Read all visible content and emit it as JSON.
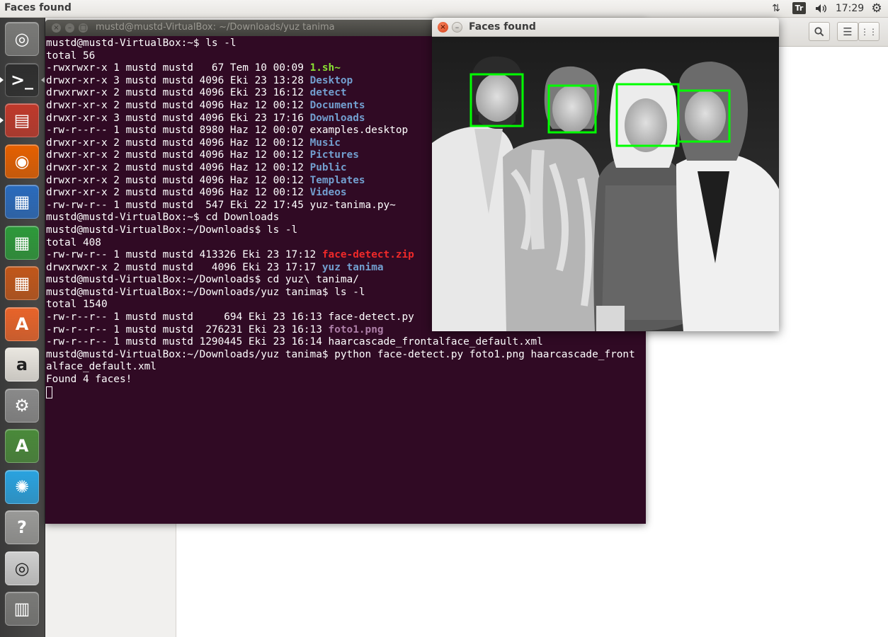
{
  "top_panel": {
    "app_title": "Faces found",
    "keyboard_indicator": "Tr",
    "clock": "17:29"
  },
  "launcher": {
    "items": [
      {
        "name": "dash-home-icon",
        "glyph": "◎",
        "color": "#7a7a78"
      },
      {
        "name": "terminal-icon",
        "glyph": ">_",
        "color": "#2e2e2e"
      },
      {
        "name": "files-icon",
        "glyph": "▤",
        "color": "#c0392b"
      },
      {
        "name": "firefox-icon",
        "glyph": "◉",
        "color": "#e66000"
      },
      {
        "name": "writer-icon",
        "glyph": "▦",
        "color": "#2a6bbd"
      },
      {
        "name": "calc-icon",
        "glyph": "▦",
        "color": "#2d9a3a"
      },
      {
        "name": "impress-icon",
        "glyph": "▦",
        "color": "#c2571a"
      },
      {
        "name": "software-center-icon",
        "glyph": "A",
        "color": "#e9642a"
      },
      {
        "name": "amazon-icon",
        "glyph": "a",
        "color": "#eae7e0"
      },
      {
        "name": "system-settings-icon",
        "glyph": "⚙",
        "color": "#8a8a8a"
      },
      {
        "name": "software-updater-icon",
        "glyph": "A",
        "color": "#4a8a3a"
      },
      {
        "name": "burst-app-icon",
        "glyph": "✺",
        "color": "#2aa3e0"
      },
      {
        "name": "help-icon",
        "glyph": "?",
        "color": "#9a9a98"
      },
      {
        "name": "dvd-icon",
        "glyph": "◎",
        "color": "#cfcfcf"
      },
      {
        "name": "trash-icon",
        "glyph": "▥",
        "color": "#7a7a78"
      }
    ]
  },
  "terminal": {
    "title": "mustd@mustd-VirtualBox: ~/Downloads/yuz tanima",
    "lines": [
      [
        {
          "t": "mustd@mustd-VirtualBox:~$ ls -l"
        }
      ],
      [
        {
          "t": "total 56"
        }
      ],
      [
        {
          "t": "-rwxrwxr-x 1 mustd mustd   67 Tem 10 00:09 "
        },
        {
          "t": "1.sh~",
          "c": "green"
        }
      ],
      [
        {
          "t": "drwxr-xr-x 3 mustd mustd 4096 Eki 23 13:28 "
        },
        {
          "t": "Desktop",
          "c": "blue"
        }
      ],
      [
        {
          "t": "drwxrwxr-x 2 mustd mustd 4096 Eki 23 16:12 "
        },
        {
          "t": "detect",
          "c": "blue"
        }
      ],
      [
        {
          "t": "drwxr-xr-x 2 mustd mustd 4096 Haz 12 00:12 "
        },
        {
          "t": "Documents",
          "c": "blue"
        }
      ],
      [
        {
          "t": "drwxr-xr-x 3 mustd mustd 4096 Eki 23 17:16 "
        },
        {
          "t": "Downloads",
          "c": "blue"
        }
      ],
      [
        {
          "t": "-rw-r--r-- 1 mustd mustd 8980 Haz 12 00:07 examples.desktop"
        }
      ],
      [
        {
          "t": "drwxr-xr-x 2 mustd mustd 4096 Haz 12 00:12 "
        },
        {
          "t": "Music",
          "c": "blue"
        }
      ],
      [
        {
          "t": "drwxr-xr-x 2 mustd mustd 4096 Haz 12 00:12 "
        },
        {
          "t": "Pictures",
          "c": "blue"
        }
      ],
      [
        {
          "t": "drwxr-xr-x 2 mustd mustd 4096 Haz 12 00:12 "
        },
        {
          "t": "Public",
          "c": "blue"
        }
      ],
      [
        {
          "t": "drwxr-xr-x 2 mustd mustd 4096 Haz 12 00:12 "
        },
        {
          "t": "Templates",
          "c": "blue"
        }
      ],
      [
        {
          "t": "drwxr-xr-x 2 mustd mustd 4096 Haz 12 00:12 "
        },
        {
          "t": "Videos",
          "c": "blue"
        }
      ],
      [
        {
          "t": "-rw-rw-r-- 1 mustd mustd  547 Eki 22 17:45 yuz-tanima.py~"
        }
      ],
      [
        {
          "t": "mustd@mustd-VirtualBox:~$ cd Downloads"
        }
      ],
      [
        {
          "t": "mustd@mustd-VirtualBox:~/Downloads$ ls -l"
        }
      ],
      [
        {
          "t": "total 408"
        }
      ],
      [
        {
          "t": "-rw-rw-r-- 1 mustd mustd 413326 Eki 23 17:12 "
        },
        {
          "t": "face-detect.zip",
          "c": "red"
        }
      ],
      [
        {
          "t": "drwxrwxr-x 2 mustd mustd   4096 Eki 23 17:17 "
        },
        {
          "t": "yuz tanima",
          "c": "blue"
        }
      ],
      [
        {
          "t": "mustd@mustd-VirtualBox:~/Downloads$ cd yuz\\ tanima/"
        }
      ],
      [
        {
          "t": "mustd@mustd-VirtualBox:~/Downloads/yuz tanima$ ls -l"
        }
      ],
      [
        {
          "t": "total 1540"
        }
      ],
      [
        {
          "t": "-rw-r--r-- 1 mustd mustd     694 Eki 23 16:13 face-detect.py"
        }
      ],
      [
        {
          "t": "-rw-r--r-- 1 mustd mustd  276231 Eki 23 16:13 "
        },
        {
          "t": "foto1.png",
          "c": "mag"
        }
      ],
      [
        {
          "t": "-rw-r--r-- 1 mustd mustd 1290445 Eki 23 16:14 haarcascade_frontalface_default.xml"
        }
      ],
      [
        {
          "t": "mustd@mustd-VirtualBox:~/Downloads/yuz tanima$ python face-detect.py foto1.png haarcascade_front"
        }
      ],
      [
        {
          "t": "alface_default.xml"
        }
      ],
      [
        {
          "t": "Found 4 faces!"
        }
      ]
    ]
  },
  "faces_window": {
    "title": "Faces found",
    "detection_box_color": "#00ff00"
  },
  "colors": {
    "terminal_bg": "#300a24",
    "ls_dir": "#729fcf",
    "ls_exec": "#8ae234",
    "ls_archive": "#ef2929",
    "ls_image": "#ad7fa8"
  }
}
